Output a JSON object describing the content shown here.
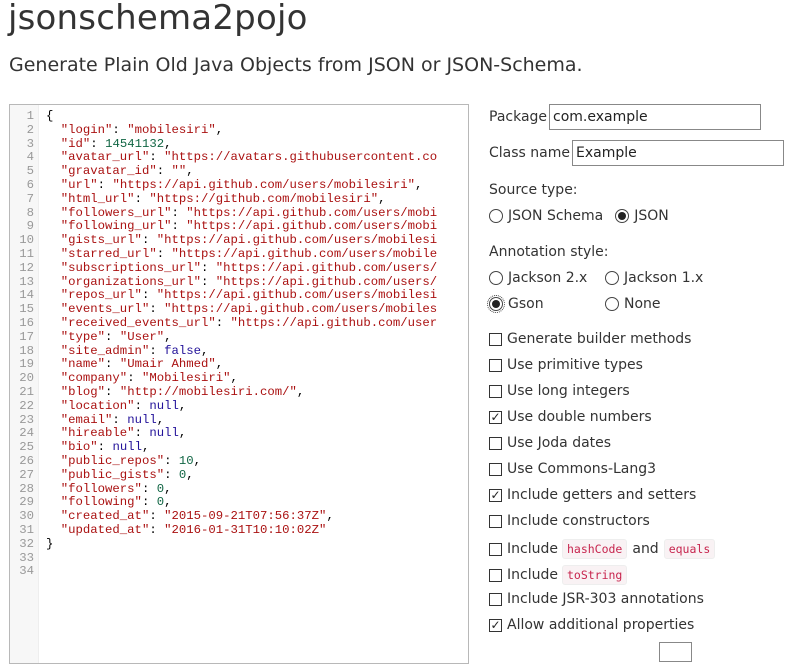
{
  "header": {
    "title": "jsonschema2pojo",
    "subtitle": "Generate Plain Old Java Objects from JSON or JSON-Schema."
  },
  "editor": {
    "line_numbers": [
      "1",
      "2",
      "3",
      "4",
      "5",
      "6",
      "7",
      "8",
      "9",
      "10",
      "11",
      "12",
      "13",
      "14",
      "15",
      "16",
      "17",
      "18",
      "19",
      "20",
      "21",
      "22",
      "23",
      "24",
      "25",
      "26",
      "27",
      "28",
      "29",
      "30",
      "31",
      "32",
      "33",
      "34"
    ],
    "lines": [
      [
        {
          "t": "brace",
          "v": "{"
        }
      ],
      [
        {
          "t": "key",
          "v": "\"login\""
        },
        {
          "t": "punct",
          "v": ": "
        },
        {
          "t": "str",
          "v": "\"mobilesiri\""
        },
        {
          "t": "punct",
          "v": ","
        }
      ],
      [
        {
          "t": "key",
          "v": "\"id\""
        },
        {
          "t": "punct",
          "v": ": "
        },
        {
          "t": "num",
          "v": "14541132"
        },
        {
          "t": "punct",
          "v": ","
        }
      ],
      [
        {
          "t": "key",
          "v": "\"avatar_url\""
        },
        {
          "t": "punct",
          "v": ": "
        },
        {
          "t": "str",
          "v": "\"https://avatars.githubusercontent.co"
        }
      ],
      [
        {
          "t": "key",
          "v": "\"gravatar_id\""
        },
        {
          "t": "punct",
          "v": ": "
        },
        {
          "t": "str",
          "v": "\"\""
        },
        {
          "t": "punct",
          "v": ","
        }
      ],
      [
        {
          "t": "key",
          "v": "\"url\""
        },
        {
          "t": "punct",
          "v": ": "
        },
        {
          "t": "str",
          "v": "\"https://api.github.com/users/mobilesiri\""
        },
        {
          "t": "punct",
          "v": ","
        }
      ],
      [
        {
          "t": "key",
          "v": "\"html_url\""
        },
        {
          "t": "punct",
          "v": ": "
        },
        {
          "t": "str",
          "v": "\"https://github.com/mobilesiri\""
        },
        {
          "t": "punct",
          "v": ","
        }
      ],
      [
        {
          "t": "key",
          "v": "\"followers_url\""
        },
        {
          "t": "punct",
          "v": ": "
        },
        {
          "t": "str",
          "v": "\"https://api.github.com/users/mobi"
        }
      ],
      [
        {
          "t": "key",
          "v": "\"following_url\""
        },
        {
          "t": "punct",
          "v": ": "
        },
        {
          "t": "str",
          "v": "\"https://api.github.com/users/mobi"
        }
      ],
      [
        {
          "t": "key",
          "v": "\"gists_url\""
        },
        {
          "t": "punct",
          "v": ": "
        },
        {
          "t": "str",
          "v": "\"https://api.github.com/users/mobilesi"
        }
      ],
      [
        {
          "t": "key",
          "v": "\"starred_url\""
        },
        {
          "t": "punct",
          "v": ": "
        },
        {
          "t": "str",
          "v": "\"https://api.github.com/users/mobile"
        }
      ],
      [
        {
          "t": "key",
          "v": "\"subscriptions_url\""
        },
        {
          "t": "punct",
          "v": ": "
        },
        {
          "t": "str",
          "v": "\"https://api.github.com/users/"
        }
      ],
      [
        {
          "t": "key",
          "v": "\"organizations_url\""
        },
        {
          "t": "punct",
          "v": ": "
        },
        {
          "t": "str",
          "v": "\"https://api.github.com/users/"
        }
      ],
      [
        {
          "t": "key",
          "v": "\"repos_url\""
        },
        {
          "t": "punct",
          "v": ": "
        },
        {
          "t": "str",
          "v": "\"https://api.github.com/users/mobilesi"
        }
      ],
      [
        {
          "t": "key",
          "v": "\"events_url\""
        },
        {
          "t": "punct",
          "v": ": "
        },
        {
          "t": "str",
          "v": "\"https://api.github.com/users/mobiles"
        }
      ],
      [
        {
          "t": "key",
          "v": "\"received_events_url\""
        },
        {
          "t": "punct",
          "v": ": "
        },
        {
          "t": "str",
          "v": "\"https://api.github.com/user"
        }
      ],
      [
        {
          "t": "key",
          "v": "\"type\""
        },
        {
          "t": "punct",
          "v": ": "
        },
        {
          "t": "str",
          "v": "\"User\""
        },
        {
          "t": "punct",
          "v": ","
        }
      ],
      [
        {
          "t": "key",
          "v": "\"site_admin\""
        },
        {
          "t": "punct",
          "v": ": "
        },
        {
          "t": "kw",
          "v": "false"
        },
        {
          "t": "punct",
          "v": ","
        }
      ],
      [
        {
          "t": "key",
          "v": "\"name\""
        },
        {
          "t": "punct",
          "v": ": "
        },
        {
          "t": "str",
          "v": "\"Umair Ahmed\""
        },
        {
          "t": "punct",
          "v": ","
        }
      ],
      [
        {
          "t": "key",
          "v": "\"company\""
        },
        {
          "t": "punct",
          "v": ": "
        },
        {
          "t": "str",
          "v": "\"Mobilesiri\""
        },
        {
          "t": "punct",
          "v": ","
        }
      ],
      [
        {
          "t": "key",
          "v": "\"blog\""
        },
        {
          "t": "punct",
          "v": ": "
        },
        {
          "t": "str",
          "v": "\"http://mobilesiri.com/\""
        },
        {
          "t": "punct",
          "v": ","
        }
      ],
      [
        {
          "t": "key",
          "v": "\"location\""
        },
        {
          "t": "punct",
          "v": ": "
        },
        {
          "t": "kw",
          "v": "null"
        },
        {
          "t": "punct",
          "v": ","
        }
      ],
      [
        {
          "t": "key",
          "v": "\"email\""
        },
        {
          "t": "punct",
          "v": ": "
        },
        {
          "t": "kw",
          "v": "null"
        },
        {
          "t": "punct",
          "v": ","
        }
      ],
      [
        {
          "t": "key",
          "v": "\"hireable\""
        },
        {
          "t": "punct",
          "v": ": "
        },
        {
          "t": "kw",
          "v": "null"
        },
        {
          "t": "punct",
          "v": ","
        }
      ],
      [
        {
          "t": "key",
          "v": "\"bio\""
        },
        {
          "t": "punct",
          "v": ": "
        },
        {
          "t": "kw",
          "v": "null"
        },
        {
          "t": "punct",
          "v": ","
        }
      ],
      [
        {
          "t": "key",
          "v": "\"public_repos\""
        },
        {
          "t": "punct",
          "v": ": "
        },
        {
          "t": "num",
          "v": "10"
        },
        {
          "t": "punct",
          "v": ","
        }
      ],
      [
        {
          "t": "key",
          "v": "\"public_gists\""
        },
        {
          "t": "punct",
          "v": ": "
        },
        {
          "t": "num",
          "v": "0"
        },
        {
          "t": "punct",
          "v": ","
        }
      ],
      [
        {
          "t": "key",
          "v": "\"followers\""
        },
        {
          "t": "punct",
          "v": ": "
        },
        {
          "t": "num",
          "v": "0"
        },
        {
          "t": "punct",
          "v": ","
        }
      ],
      [
        {
          "t": "key",
          "v": "\"following\""
        },
        {
          "t": "punct",
          "v": ": "
        },
        {
          "t": "num",
          "v": "0"
        },
        {
          "t": "punct",
          "v": ","
        }
      ],
      [
        {
          "t": "key",
          "v": "\"created_at\""
        },
        {
          "t": "punct",
          "v": ": "
        },
        {
          "t": "str",
          "v": "\"2015-09-21T07:56:37Z\""
        },
        {
          "t": "punct",
          "v": ","
        }
      ],
      [
        {
          "t": "key",
          "v": "\"updated_at\""
        },
        {
          "t": "punct",
          "v": ": "
        },
        {
          "t": "str",
          "v": "\"2016-01-31T10:10:02Z\""
        }
      ],
      [
        {
          "t": "brace",
          "v": "}"
        }
      ],
      [],
      []
    ],
    "indent": [
      0,
      1,
      1,
      1,
      1,
      1,
      1,
      1,
      1,
      1,
      1,
      1,
      1,
      1,
      1,
      1,
      1,
      1,
      1,
      1,
      1,
      1,
      1,
      1,
      1,
      1,
      1,
      1,
      1,
      1,
      1,
      0,
      0,
      0
    ]
  },
  "options": {
    "package_label": "Package",
    "package_value": "com.example",
    "classname_label": "Class name",
    "classname_value": "Example",
    "source_type_label": "Source type:",
    "source_types": [
      {
        "label": "JSON Schema",
        "checked": false
      },
      {
        "label": "JSON",
        "checked": true
      }
    ],
    "annotation_style_label": "Annotation style:",
    "annotation_styles": [
      {
        "label": "Jackson 2.x",
        "checked": false
      },
      {
        "label": "Jackson 1.x",
        "checked": false
      },
      {
        "label": "Gson",
        "checked": true
      },
      {
        "label": "None",
        "checked": false
      }
    ],
    "checkboxes": [
      {
        "label": "Generate builder methods",
        "checked": false
      },
      {
        "label": "Use primitive types",
        "checked": false
      },
      {
        "label": "Use long integers",
        "checked": false
      },
      {
        "label": "Use double numbers",
        "checked": true
      },
      {
        "label": "Use Joda dates",
        "checked": false
      },
      {
        "label": "Use Commons-Lang3",
        "checked": false
      },
      {
        "label": "Include getters and setters",
        "checked": true
      },
      {
        "label": "Include constructors",
        "checked": false
      },
      {
        "label_prefix": "Include",
        "chip1": "hashCode",
        "label_and": "and",
        "chip2": "equals",
        "checked": false
      },
      {
        "label_prefix": "Include",
        "chip1": "toString",
        "checked": false
      },
      {
        "label": "Include JSR-303 annotations",
        "checked": false
      },
      {
        "label": "Allow additional properties",
        "checked": true
      }
    ],
    "check_mark": "✓"
  }
}
